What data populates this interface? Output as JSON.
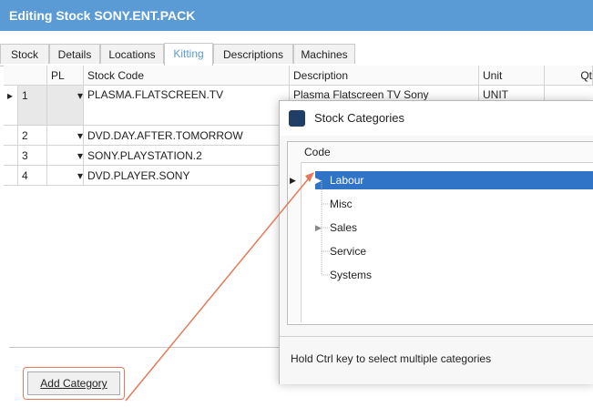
{
  "window": {
    "title": "Editing Stock SONY.ENT.PACK"
  },
  "tabs": [
    "Stock",
    "Details",
    "Locations",
    "Kitting",
    "Descriptions",
    "Machines"
  ],
  "grid": {
    "headers": [
      "PL",
      "Stock Code",
      "Description",
      "Unit",
      "Qt"
    ],
    "rows": [
      {
        "num": "1",
        "code": "PLASMA.FLATSCREEN.TV",
        "desc": "Plasma Flatscreen TV Sony",
        "unit": "UNIT"
      },
      {
        "num": "2",
        "code": "DVD.DAY.AFTER.TOMORROW",
        "desc": "",
        "unit": ""
      },
      {
        "num": "3",
        "code": "SONY.PLAYSTATION.2",
        "desc": "",
        "unit": ""
      },
      {
        "num": "4",
        "code": "DVD.PLAYER.SONY",
        "desc": "",
        "unit": ""
      }
    ]
  },
  "button": {
    "add_category": "Add Category"
  },
  "dialog": {
    "title": "Stock Categories",
    "column_header": "Code",
    "categories": [
      "Labour",
      "Misc",
      "Sales",
      "Service",
      "Systems"
    ],
    "hint": "Hold Ctrl key to select multiple categories"
  },
  "colors": {
    "accent": "#5b9bd5",
    "selection": "#2f74c6",
    "callout": "#e57a5a"
  }
}
